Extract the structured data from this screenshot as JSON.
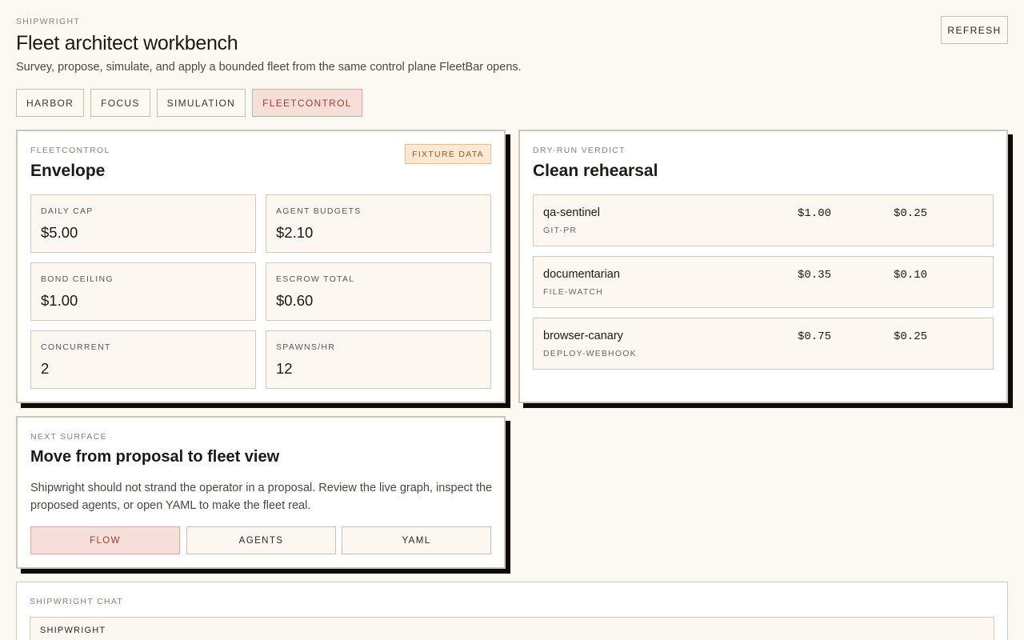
{
  "header": {
    "brand": "SHIPWRIGHT",
    "title": "Fleet architect workbench",
    "subtitle": "Survey, propose, simulate, and apply a bounded fleet from the same control plane FleetBar opens.",
    "refresh_label": "REFRESH"
  },
  "tabs": [
    {
      "label": "HARBOR",
      "active": false
    },
    {
      "label": "FOCUS",
      "active": false
    },
    {
      "label": "SIMULATION",
      "active": false
    },
    {
      "label": "FLEETCONTROL",
      "active": true
    }
  ],
  "envelope": {
    "eyebrow": "FLEETCONTROL",
    "title": "Envelope",
    "badge": "FIXTURE DATA",
    "stats": [
      {
        "label": "DAILY CAP",
        "value": "$5.00"
      },
      {
        "label": "AGENT BUDGETS",
        "value": "$2.10"
      },
      {
        "label": "BOND CEILING",
        "value": "$1.00"
      },
      {
        "label": "ESCROW TOTAL",
        "value": "$0.60"
      },
      {
        "label": "CONCURRENT",
        "value": "2"
      },
      {
        "label": "SPAWNS/HR",
        "value": "12"
      }
    ]
  },
  "verdict": {
    "eyebrow": "DRY-RUN VERDICT",
    "title": "Clean rehearsal",
    "agents": [
      {
        "name": "qa-sentinel",
        "trigger": "GIT-PR",
        "cost_a": "$1.00",
        "cost_b": "$0.25"
      },
      {
        "name": "documentarian",
        "trigger": "FILE-WATCH",
        "cost_a": "$0.35",
        "cost_b": "$0.10"
      },
      {
        "name": "browser-canary",
        "trigger": "DEPLOY-WEBHOOK",
        "cost_a": "$0.75",
        "cost_b": "$0.25"
      }
    ]
  },
  "next_surface": {
    "eyebrow": "NEXT SURFACE",
    "title": "Move from proposal to fleet view",
    "body": "Shipwright should not strand the operator in a proposal. Review the live graph, inspect the proposed agents, or open YAML to make the fleet real.",
    "actions": [
      {
        "label": "FLOW",
        "active": true
      },
      {
        "label": "AGENTS",
        "active": false
      },
      {
        "label": "YAML",
        "active": false
      }
    ]
  },
  "chat": {
    "eyebrow": "SHIPWRIGHT CHAT",
    "message_author": "SHIPWRIGHT"
  },
  "colors": {
    "background": "#fcf9f3",
    "accent": "#a23c2c",
    "accent_bg": "#f6dfd9",
    "badge_bg": "#fbe9d6",
    "badge_text": "#9b5b22"
  }
}
